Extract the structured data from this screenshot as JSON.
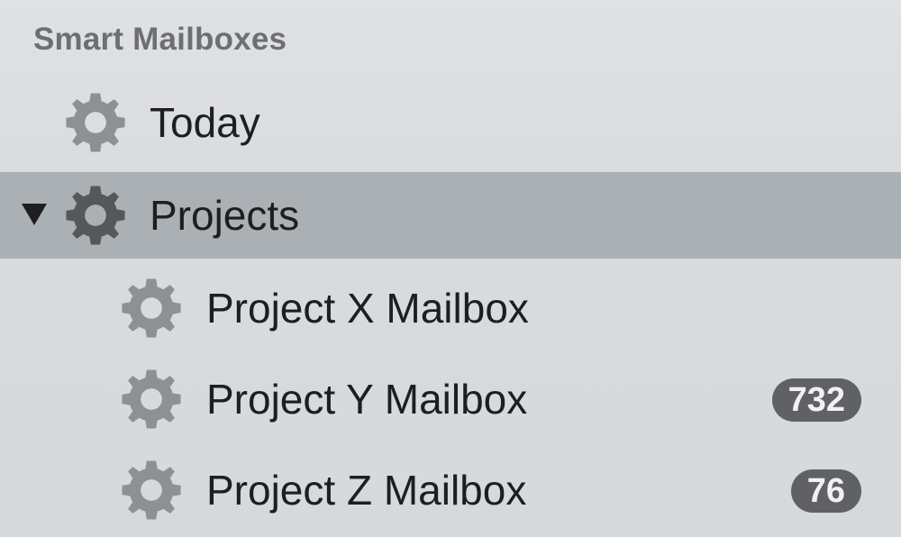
{
  "sidebar": {
    "section_title": "Smart Mailboxes",
    "items": [
      {
        "label": "Today",
        "icon": "gear-icon",
        "badge": null
      },
      {
        "label": "Projects",
        "icon": "gear-icon",
        "badge": null,
        "expanded": true,
        "selected": true
      },
      {
        "label": "Project X Mailbox",
        "icon": "gear-icon",
        "badge": null
      },
      {
        "label": "Project Y Mailbox",
        "icon": "gear-icon",
        "badge": "732"
      },
      {
        "label": "Project Z Mailbox",
        "icon": "gear-icon",
        "badge": "76"
      }
    ]
  },
  "colors": {
    "background": "#d9dcdf",
    "selection": "#abb0b5",
    "gear": "#8e9094",
    "gear_selected": "#55575a",
    "badge": "#5f6164"
  }
}
